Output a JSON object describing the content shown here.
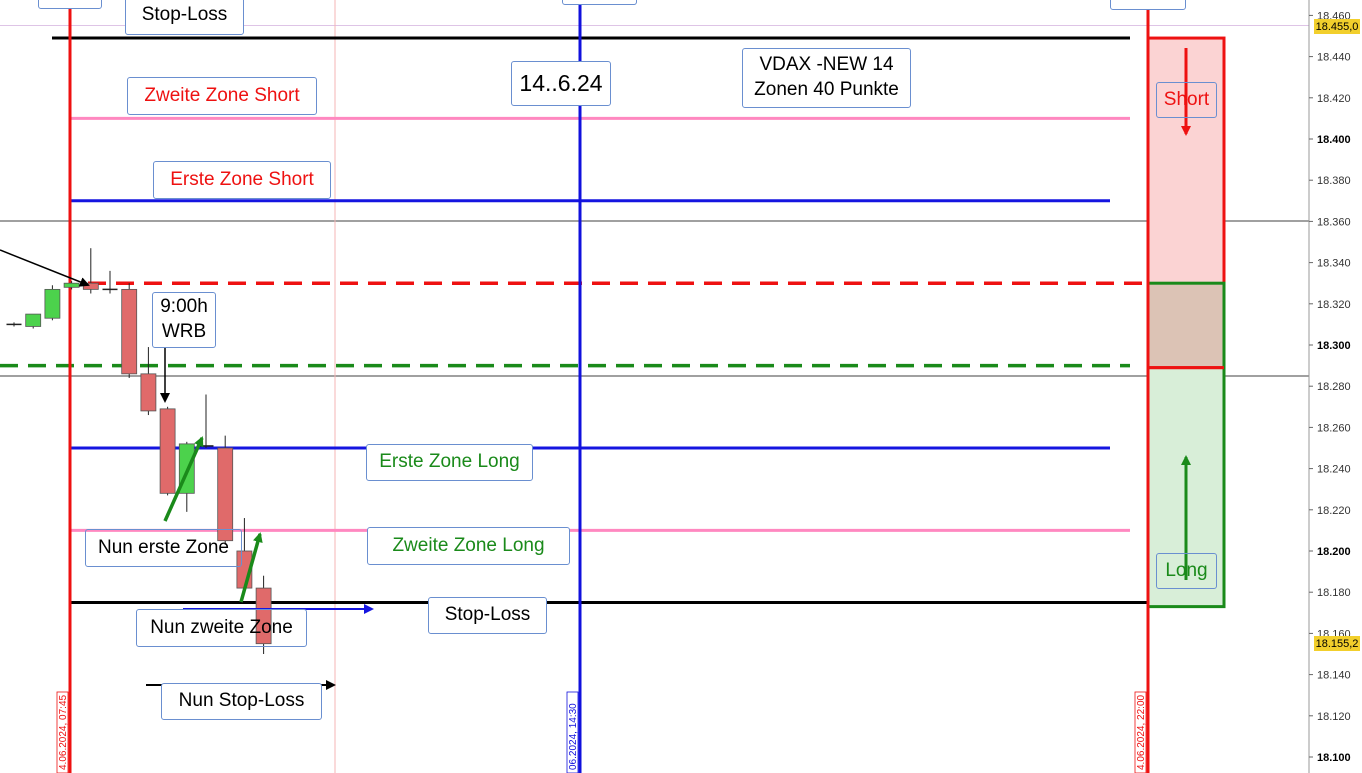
{
  "chart_data": {
    "type": "candlestick",
    "instrument": "VDAX -NEW 14",
    "subtitle": "Zonen 40 Punkte",
    "date_note": "14..6.24",
    "y_axis": {
      "range": [
        18092,
        18468
      ],
      "ticks": [
        18460,
        18440,
        18420,
        18400,
        18380,
        18360,
        18340,
        18320,
        18300,
        18280,
        18260,
        18240,
        18220,
        18200,
        18180,
        18160,
        18140,
        18120,
        18100
      ],
      "tick_labels": [
        "18.460",
        "18.440",
        "18.420",
        "18.400",
        "18.380",
        "18.360",
        "18.340",
        "18.320",
        "18.300",
        "18.280",
        "18.260",
        "18.240",
        "18.220",
        "18.200",
        "18.180",
        "18.160",
        "18.140",
        "18.120",
        "18.100"
      ],
      "major_ticks": [
        18400,
        18300,
        18200,
        18100
      ]
    },
    "price_badges": [
      {
        "value": 18455,
        "label": "18.455,0"
      },
      {
        "value": 18155.2,
        "label": "18.155,2"
      }
    ],
    "time_markers": [
      {
        "label": "4.06.2024, 07:45",
        "color": "#ee1111"
      },
      {
        "label": "06.2024, 14:30",
        "color": "#1111dd"
      },
      {
        "label": "4.06.2024, 22:00",
        "color": "#ee1111"
      }
    ],
    "candles": [
      {
        "open": 18310,
        "high": 18311,
        "low": 18309,
        "close": 18310
      },
      {
        "open": 18309,
        "high": 18315,
        "low": 18308,
        "close": 18315
      },
      {
        "open": 18313,
        "high": 18329,
        "low": 18312,
        "close": 18327
      },
      {
        "open": 18328,
        "high": 18331,
        "low": 18327,
        "close": 18330
      },
      {
        "open": 18330,
        "high": 18347,
        "low": 18325,
        "close": 18327
      },
      {
        "open": 18327,
        "high": 18336,
        "low": 18325,
        "close": 18327
      },
      {
        "open": 18327,
        "high": 18330,
        "low": 18284,
        "close": 18286
      },
      {
        "open": 18286,
        "high": 18299,
        "low": 18266,
        "close": 18268
      },
      {
        "open": 18269,
        "high": 18270,
        "low": 18227,
        "close": 18228
      },
      {
        "open": 18228,
        "high": 18253,
        "low": 18219,
        "close": 18252
      },
      {
        "open": 18251,
        "high": 18276,
        "low": 18250,
        "close": 18251
      },
      {
        "open": 18250,
        "high": 18256,
        "low": 18203,
        "close": 18205
      },
      {
        "open": 18200,
        "high": 18216,
        "low": 18181,
        "close": 18182
      },
      {
        "open": 18182,
        "high": 18188,
        "low": 18150,
        "close": 18155
      }
    ],
    "levels": [
      {
        "name": "stop-loss-short",
        "value": 18449,
        "color": "#000000",
        "dash": false
      },
      {
        "name": "zweite-zone-short",
        "value": 18410,
        "color": "#ff88c0",
        "dash": false
      },
      {
        "name": "erste-zone-short",
        "value": 18370,
        "color": "#1515e0",
        "dash": false
      },
      {
        "name": "short-trigger",
        "value": 18330,
        "color": "#ee1111",
        "dash": true
      },
      {
        "name": "long-trigger",
        "value": 18290,
        "color": "#1a8a1a",
        "dash": true
      },
      {
        "name": "erste-zone-long",
        "value": 18250,
        "color": "#1515e0",
        "dash": false
      },
      {
        "name": "zweite-zone-long",
        "value": 18210,
        "color": "#ff88c0",
        "dash": false
      },
      {
        "name": "stop-loss-long",
        "value": 18175,
        "color": "#000000",
        "dash": false
      }
    ],
    "zones": [
      {
        "name": "short-zone",
        "from": 18330,
        "to": 18449,
        "label": "Short",
        "fill": "#fbd3d3"
      },
      {
        "name": "overlap-zone",
        "from": 18289,
        "to": 18330,
        "label": "",
        "fill": "#dcc3b5"
      },
      {
        "name": "long-zone",
        "from": 18173,
        "to": 18289,
        "label": "Long",
        "fill": "#d8eed8"
      }
    ]
  },
  "labels": {
    "stop_loss_top": "Stop-Loss",
    "zweite_zone_short": "Zweite Zone Short",
    "erste_zone_short": "Erste Zone Short",
    "title_line1": "VDAX -NEW 14",
    "title_line2": "Zonen 40 Punkte",
    "date_box": "14..6.24",
    "wrb_line1": "9:00h",
    "wrb_line2": "WRB",
    "erste_zone_long": "Erste Zone Long",
    "zweite_zone_long": "Zweite Zone Long",
    "nun_erste_zone": "Nun erste Zone",
    "nun_zweite_zone": "Nun zweite Zone",
    "stop_loss_bottom": "Stop-Loss",
    "nun_stop_loss": "Nun Stop-Loss",
    "short": "Short",
    "long": "Long"
  },
  "colors": {
    "up_candle": "#4cd24c",
    "down_candle": "#e06a6a",
    "red": "#ee1111",
    "blue": "#1515e0",
    "green": "#1a8a1a",
    "short_text": "#ee1111",
    "long_text": "#1a8a1a"
  }
}
